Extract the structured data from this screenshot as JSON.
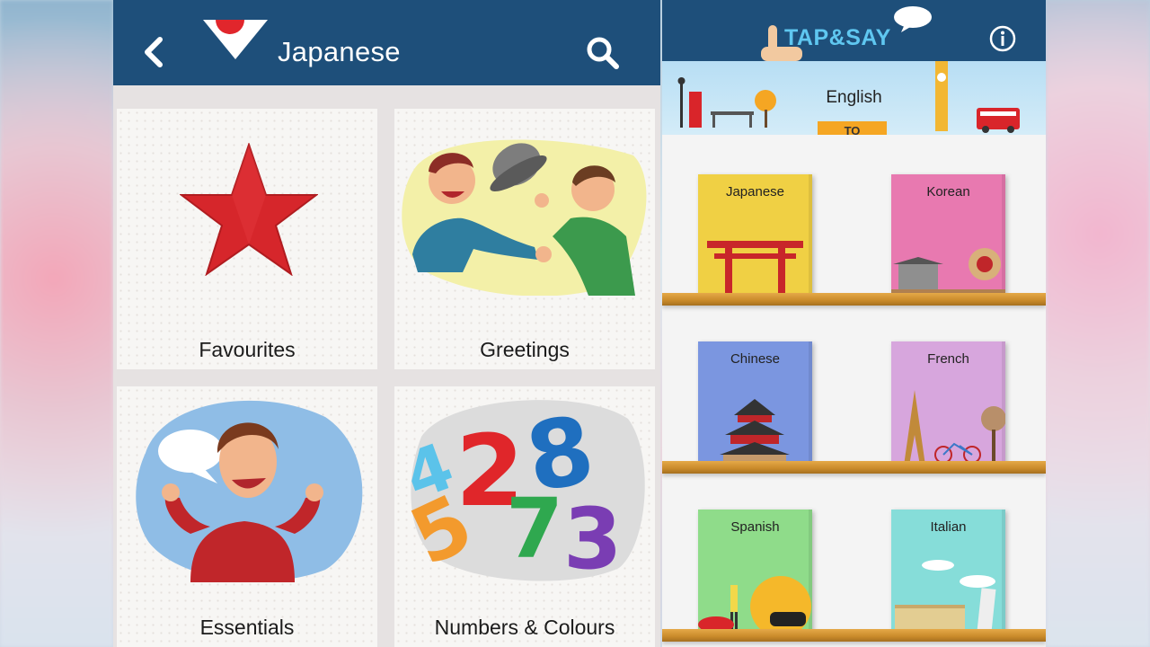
{
  "left_app": {
    "header": {
      "title": "Japanese",
      "back_icon": "chevron-left-icon",
      "flag_icon": "japan-flag-icon",
      "search_icon": "search-icon",
      "background_color": "#1e4f7a"
    },
    "categories": [
      {
        "label": "Favourites",
        "icon": "star-icon"
      },
      {
        "label": "Greetings",
        "icon": "greeting-people-illustration"
      },
      {
        "label": "Essentials",
        "icon": "talking-man-illustration"
      },
      {
        "label": "Numbers & Colours",
        "icon": "numbers-illustration"
      }
    ]
  },
  "right_app": {
    "header": {
      "brand": "TAP&SAY",
      "info_icon": "info-icon",
      "background_color": "#1e4f7a"
    },
    "source_language": "English",
    "to_label": "TO",
    "languages": [
      {
        "label": "Japanese",
        "color": "#f0d044"
      },
      {
        "label": "Korean",
        "color": "#e879b0"
      },
      {
        "label": "Chinese",
        "color": "#7b96e0"
      },
      {
        "label": "French",
        "color": "#d7a6dd"
      },
      {
        "label": "Spanish",
        "color": "#8fdc8a"
      },
      {
        "label": "Italian",
        "color": "#86ddd9"
      }
    ]
  }
}
